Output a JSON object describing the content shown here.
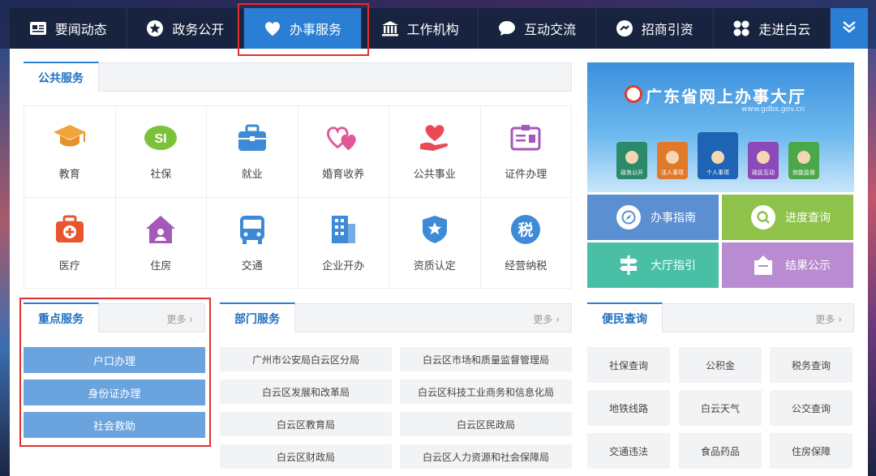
{
  "nav": {
    "items": [
      {
        "label": "要闻动态",
        "icon": "newspaper-icon"
      },
      {
        "label": "政务公开",
        "icon": "star-icon"
      },
      {
        "label": "办事服务",
        "icon": "heart-icon",
        "active": true
      },
      {
        "label": "工作机构",
        "icon": "building-icon"
      },
      {
        "label": "互动交流",
        "icon": "chat-bubble-icon"
      },
      {
        "label": "招商引资",
        "icon": "handshake-icon"
      },
      {
        "label": "走进白云",
        "icon": "grid-icon"
      }
    ],
    "more_icon": "chevron-double-down-icon"
  },
  "public_services": {
    "tab_label": "公共服务",
    "items": [
      {
        "label": "教育",
        "icon": "graduation-cap-icon",
        "color": "#f0a53a"
      },
      {
        "label": "社保",
        "icon": "social-security-icon",
        "color": "#7cc13a"
      },
      {
        "label": "就业",
        "icon": "briefcase-icon",
        "color": "#3d8ad6"
      },
      {
        "label": "婚育收养",
        "icon": "hearts-icon",
        "color": "#e2569a"
      },
      {
        "label": "公共事业",
        "icon": "hand-heart-icon",
        "color": "#e94a55"
      },
      {
        "label": "证件办理",
        "icon": "id-card-icon",
        "color": "#a458b8"
      },
      {
        "label": "医疗",
        "icon": "medical-kit-icon",
        "color": "#e8552f"
      },
      {
        "label": "住房",
        "icon": "house-icon",
        "color": "#a458b8"
      },
      {
        "label": "交通",
        "icon": "bus-icon",
        "color": "#3d8ad6"
      },
      {
        "label": "企业开办",
        "icon": "office-building-icon",
        "color": "#3d8ad6"
      },
      {
        "label": "资质认定",
        "icon": "badge-star-icon",
        "color": "#3d8ad6"
      },
      {
        "label": "经营纳税",
        "icon": "tax-icon",
        "color": "#3d8ad6",
        "glyph": "税"
      }
    ]
  },
  "banner": {
    "title": "广东省网上办事大厅",
    "url": "www.gdbs.gov.cn",
    "tiles": [
      "政务公开",
      "法人事项",
      "个人事项",
      "政民互动",
      "效能监督"
    ]
  },
  "quick_buttons": [
    {
      "label": "办事指南",
      "icon": "compass-icon",
      "color": "#5b8fd1"
    },
    {
      "label": "进度查询",
      "icon": "magnifier-icon",
      "color": "#8ec24a"
    },
    {
      "label": "大厅指引",
      "icon": "signpost-icon",
      "color": "#49bfa5"
    },
    {
      "label": "结果公示",
      "icon": "shop-icon",
      "color": "#b98bd0"
    }
  ],
  "key_services": {
    "tab_label": "重点服务",
    "more": "更多",
    "items": [
      "户口办理",
      "身份证办理",
      "社会救助"
    ]
  },
  "dept_services": {
    "tab_label": "部门服务",
    "more": "更多",
    "items": [
      "广州市公安局白云区分局",
      "白云区市场和质量监督管理局",
      "白云区发展和改革局",
      "白云区科技工业商务和信息化局",
      "白云区教育局",
      "白云区民政局",
      "白云区财政局",
      "白云区人力资源和社会保障局"
    ]
  },
  "civil_query": {
    "tab_label": "便民查询",
    "more": "更多",
    "items": [
      "社保查询",
      "公积金",
      "税务查询",
      "地铁线路",
      "白云天气",
      "公交查询",
      "交通违法",
      "食品药品",
      "住房保障"
    ]
  },
  "colors": {
    "nav_bg": "#17233f",
    "accent": "#2a7fd4",
    "highlight_frame": "#e0302f"
  }
}
